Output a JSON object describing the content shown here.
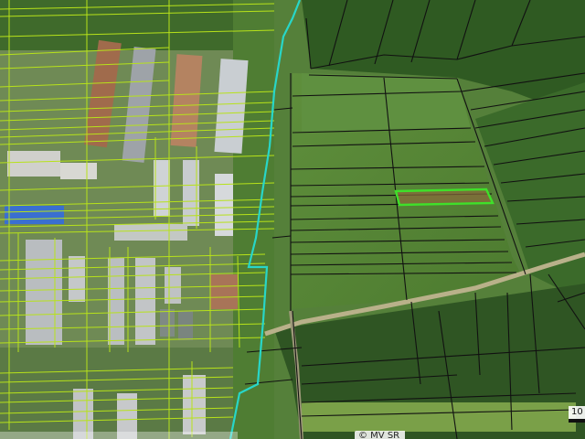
{
  "map": {
    "attribution": "© MV SR",
    "scale_label": "10",
    "colors": {
      "cadastre_lines": "#b7e21a",
      "parcel_lines": "#111111",
      "boundary": "#28d6c8",
      "highlight_border": "#3fe02a"
    },
    "layers": [
      "orthophoto",
      "cadastral-parcels",
      "building-parcels",
      "district-boundary",
      "selected-parcel"
    ]
  }
}
